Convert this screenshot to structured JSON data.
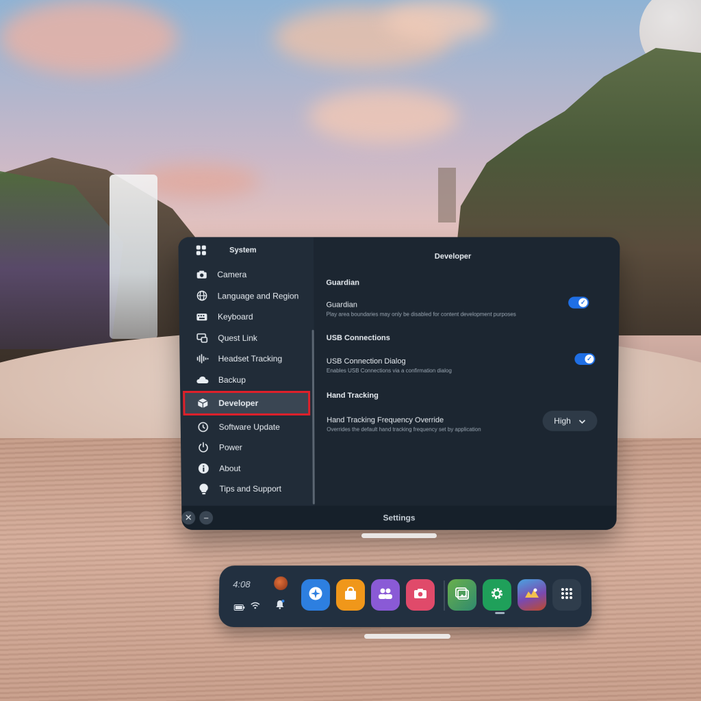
{
  "panel": {
    "sidebar_title": "System",
    "nav_items": [
      {
        "label": "Camera",
        "icon": "camera-icon"
      },
      {
        "label": "Language and Region",
        "icon": "globe-icon"
      },
      {
        "label": "Keyboard",
        "icon": "keyboard-icon"
      },
      {
        "label": "Quest Link",
        "icon": "link-icon"
      },
      {
        "label": "Headset Tracking",
        "icon": "tracking-icon"
      },
      {
        "label": "Backup",
        "icon": "cloud-icon"
      },
      {
        "label": "Developer",
        "icon": "cube-icon",
        "selected": true
      },
      {
        "label": "Software Update",
        "icon": "update-icon"
      },
      {
        "label": "Power",
        "icon": "power-icon"
      },
      {
        "label": "About",
        "icon": "info-icon"
      },
      {
        "label": "Tips and Support",
        "icon": "lightbulb-icon"
      }
    ],
    "content_title": "Developer",
    "sections": {
      "guardian": {
        "heading": "Guardian",
        "title": "Guardian",
        "subtitle": "Play area boundaries may only be disabled for content development purposes",
        "enabled": true
      },
      "usb": {
        "heading": "USB Connections",
        "title": "USB Connection Dialog",
        "subtitle": "Enables USB Connections via a confirmation dialog",
        "enabled": true
      },
      "hand": {
        "heading": "Hand Tracking",
        "title": "Hand Tracking Frequency Override",
        "subtitle": "Overrides the default hand tracking frequency set by application",
        "value": "High"
      }
    },
    "footer_title": "Settings"
  },
  "dock": {
    "time": "4:08",
    "apps": [
      {
        "name": "explore",
        "icon": "compass-icon",
        "color": "#2d7fe0"
      },
      {
        "name": "store",
        "icon": "bag-icon",
        "color": "#f0971a"
      },
      {
        "name": "people",
        "icon": "people-icon",
        "color": "#8a5ad6"
      },
      {
        "name": "camera",
        "icon": "camera-icon",
        "color": "#e04a6a"
      },
      {
        "name": "files",
        "icon": "photos-icon",
        "color": "#4aa56a"
      },
      {
        "name": "settings",
        "icon": "gear-icon",
        "color": "#1fa05a"
      },
      {
        "name": "game",
        "icon": "game-icon",
        "color": "#6a4aa0"
      },
      {
        "name": "app-library",
        "icon": "grid-icon",
        "color": "#2f3d4c"
      }
    ]
  },
  "colors": {
    "accent": "#1f6fe5",
    "highlight": "#e0202a",
    "panel": "#1c2631"
  }
}
